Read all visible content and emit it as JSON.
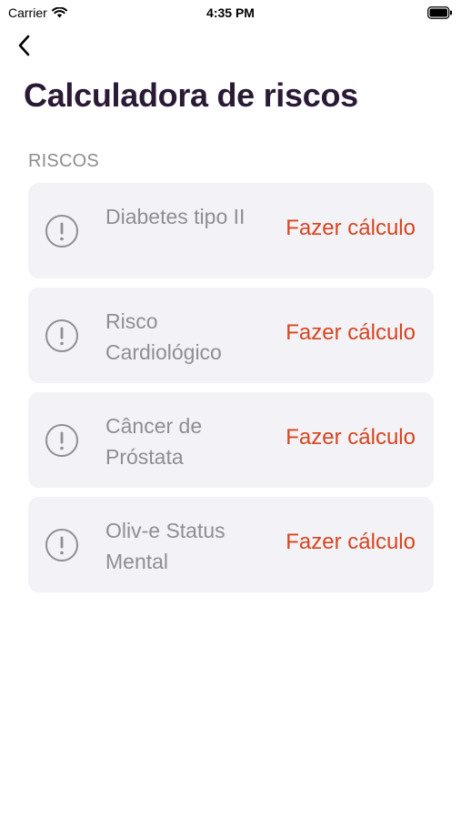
{
  "status_bar": {
    "carrier": "Carrier",
    "time": "4:35 PM"
  },
  "nav": {
    "back_icon": "chevron-left-icon"
  },
  "page": {
    "title": "Calculadora de riscos",
    "section_header": "RISCOS"
  },
  "risks": [
    {
      "label": "Diabetes tipo II",
      "action": "Fazer cálculo",
      "icon": "exclamation-circle-icon"
    },
    {
      "label": "Risco Cardiológico",
      "action": "Fazer cálculo",
      "icon": "exclamation-circle-icon"
    },
    {
      "label": "Câncer de Próstata",
      "action": "Fazer cálculo",
      "icon": "exclamation-circle-icon"
    },
    {
      "label": "Oliv-e Status Mental",
      "action": "Fazer cálculo",
      "icon": "exclamation-circle-icon"
    }
  ],
  "colors": {
    "title": "#2a1a36",
    "muted": "#8e8e93",
    "accent": "#d9451f",
    "card_background": "#f2f2f7"
  }
}
